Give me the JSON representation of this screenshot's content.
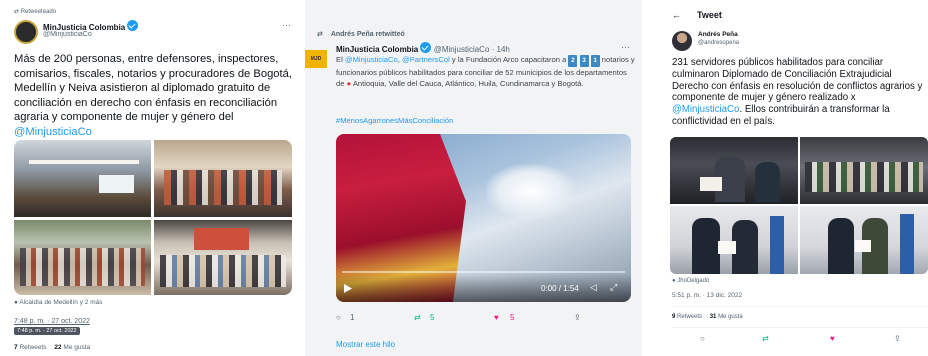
{
  "tweet1": {
    "retweet_label": "Retweeteado",
    "author_name": "MinJusticia Colombia",
    "author_handle": "@MinjusticiaCo",
    "more": "···",
    "text_main": "Más de 200 personas, entre defensores, inspectores, comisarios, fiscales, notarios y procuradores de Bogotá, Medellín y Neiva asistieron al diplomado gratuito de conciliación en derecho con énfasis en reconciliación agraria y componente de mujer y género del ",
    "text_mention": "@MinjusticiaCo",
    "tagged": "Alcaldía de Medellín y 2 más",
    "timestamp": "7:48 p. m. · 27 oct. 2022",
    "tooltip": "7:48 p. m. · 27 oct. 2022",
    "retweets_count": "7",
    "retweets_label": "Retweets",
    "likes_count": "22",
    "likes_label": "Me gusta"
  },
  "tweet2": {
    "retweet_label": "Andrés Peña retwitteó",
    "author_name": "MinJusticia Colombia",
    "author_handle": "@MinjusticiaCo",
    "time": "· 14h",
    "more": "···",
    "avatar_text": "MJD",
    "text_pre": "El ",
    "mention1": "@MinjusticiaCo",
    "sep1": ", ",
    "mention2": "@PartnersCol",
    "text_mid": " y la Fundación Arco capacitaron a ",
    "emoji1": "2",
    "emoji2": "3",
    "emoji3": "1",
    "text_post": " notarios y funcionarios públicos habilitados para conciliar de 52 municipios de los departamentos de ",
    "text_end": " Antioquia, Valle del Cauca, Atlántico, Huila, Cundinamarca y Bogotá.",
    "hashtag": "#MenosAgarronesMásConciliación",
    "video_time": "0:00 / 1:54",
    "reply_count": "1",
    "retweet_count": "5",
    "like_count": "5",
    "show_thread": "Mostrar este hilo",
    "colors": {
      "retweet": "#00ba7c",
      "like": "#f91880"
    }
  },
  "tweet3": {
    "header": "Tweet",
    "author_name": "Andrés Peña",
    "author_handle": "@andresopena",
    "text_main": "231 servidores públicos habilitados para conciliar culminaron Diplomado de Conciliación Extrajudicial Derecho con énfasis en resolución de conflictos agrarios y componente de mujer y género realizado x ",
    "text_mention": "@MinjusticiaCo",
    "text_end": ". Ellos contribuirán a transformar la conflictividad en el país.",
    "tagged": "JhoDelgado",
    "timestamp": "5:51 p. m. · 13 dic. 2022",
    "retweets_count": "9",
    "retweets_label": "Retweets",
    "likes_count": "31",
    "likes_label": "Me gusta"
  }
}
